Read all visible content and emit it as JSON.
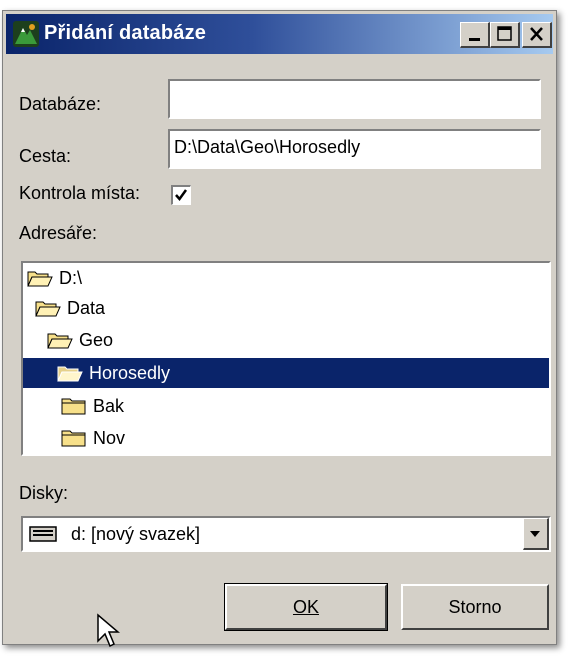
{
  "window": {
    "title": "Přidání databáze",
    "controls": {
      "minimize": "minimize-icon",
      "maximize": "maximize-icon",
      "close": "close-icon"
    }
  },
  "form": {
    "database_label": "Databáze:",
    "database_value": "",
    "path_label": "Cesta:",
    "path_value": "D:\\Data\\Geo\\Horosedly",
    "location_check_label": "Kontrola místa:",
    "location_check_checked": true,
    "directories_label": "Adresáře:",
    "directories": [
      {
        "label": "D:\\",
        "icon": "folder-open-icon",
        "selected": false
      },
      {
        "label": "Data",
        "icon": "folder-open-icon",
        "selected": false
      },
      {
        "label": "Geo",
        "icon": "folder-open-icon",
        "selected": false
      },
      {
        "label": "Horosedly",
        "icon": "folder-open-icon",
        "selected": true
      },
      {
        "label": "Bak",
        "icon": "folder-closed-icon",
        "selected": false
      },
      {
        "label": "Nov",
        "icon": "folder-closed-icon",
        "selected": false
      }
    ],
    "drives_label": "Disky:",
    "drive_value": "d: [nový svazek]"
  },
  "buttons": {
    "ok": "OK",
    "cancel": "Storno"
  },
  "colors": {
    "title_start": "#0a246a",
    "title_end": "#a6caf0",
    "face": "#d4d0c8",
    "selection": "#0a246a"
  }
}
